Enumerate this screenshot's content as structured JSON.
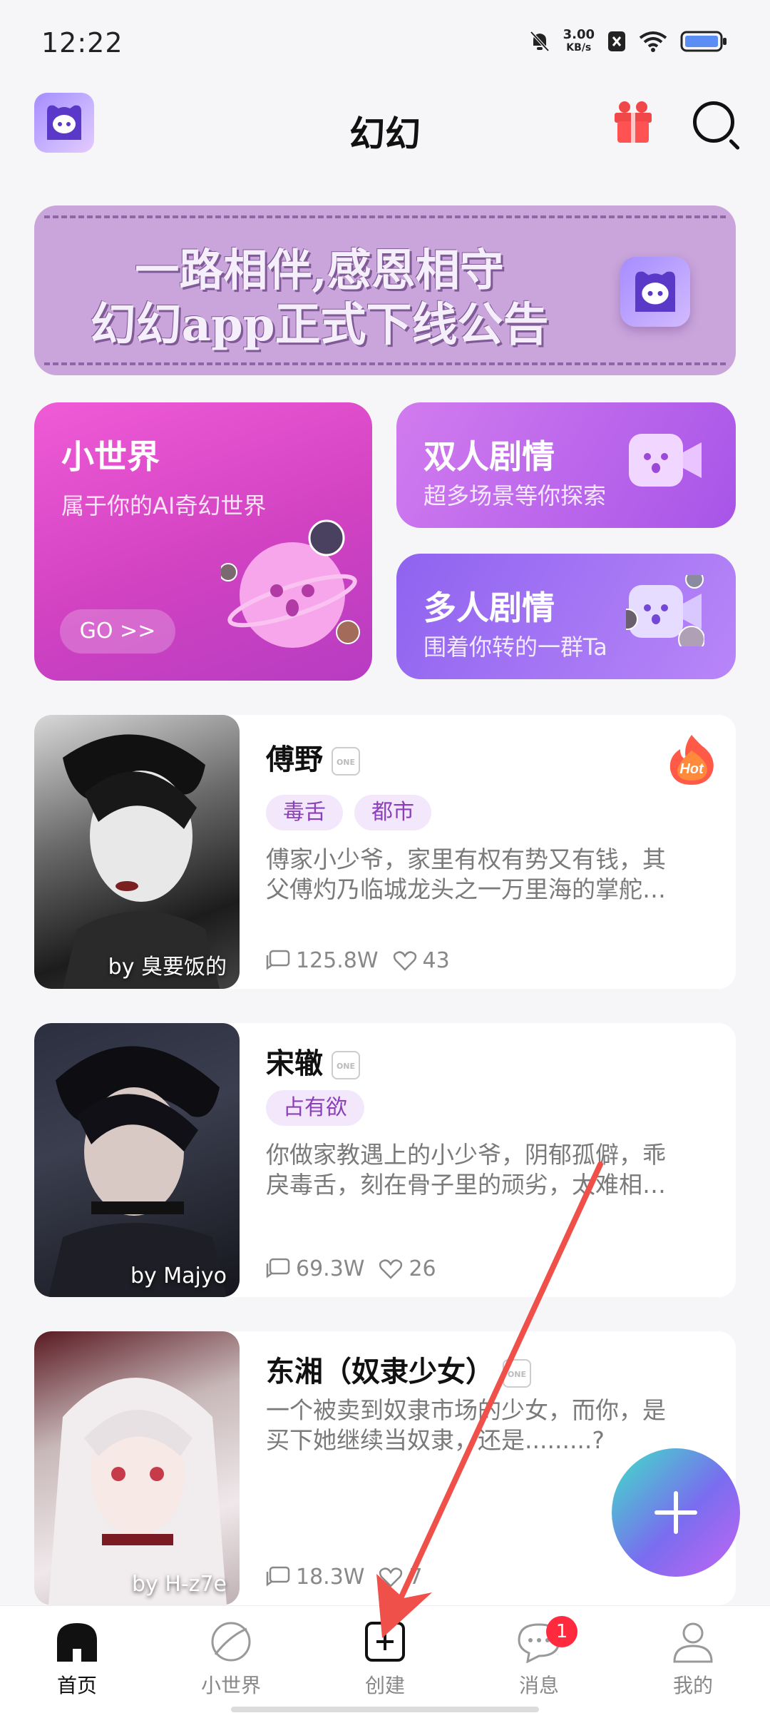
{
  "status": {
    "time": "12:22",
    "speed_value": "3.00",
    "speed_unit": "KB/s"
  },
  "header": {
    "title": "幻幻"
  },
  "banner": {
    "line1": "一路相伴,感恩相守",
    "line2": "幻幻app正式下线公告"
  },
  "features": {
    "world": {
      "title": "小世界",
      "subtitle": "属于你的AI奇幻世界",
      "go": "GO >>"
    },
    "duo": {
      "title": "双人剧情",
      "subtitle": "超多场景等你探索"
    },
    "multi": {
      "title": "多人剧情",
      "subtitle": "围着你转的一群Ta"
    }
  },
  "items": [
    {
      "name": "傅野",
      "tags": [
        "毒舌",
        "都市"
      ],
      "desc1": "傅家小少爷，家里有权有势又有钱，其",
      "desc2": "父傅灼乃临城龙头之一万里海的掌舵…",
      "chats": "125.8W",
      "likes": "43",
      "author": "by 臭要饭的",
      "hot": "Hot"
    },
    {
      "name": "宋辙",
      "tags": [
        "占有欲"
      ],
      "desc1": "你做家教遇上的小少爷，阴郁孤僻，乖",
      "desc2": "戾毒舌，刻在骨子里的顽劣，太难相…",
      "chats": "69.3W",
      "likes": "26",
      "author": "by Majyo"
    },
    {
      "name": "东湘（奴隶少女）",
      "tags": [],
      "desc1": "一个被卖到奴隶市场的少女，而你，是",
      "desc2": "买下她继续当奴隶，还是.........?",
      "chats": "18.3W",
      "likes": "7",
      "author": "by H-z7e"
    }
  ],
  "nav": {
    "home": "首页",
    "world": "小世界",
    "create": "创建",
    "messages": "消息",
    "mine": "我的",
    "badge": "1"
  },
  "colors": {
    "accent": "#8b3fb8",
    "badge": "#ff2a3d",
    "annotation_arrow": "#f0504a"
  }
}
